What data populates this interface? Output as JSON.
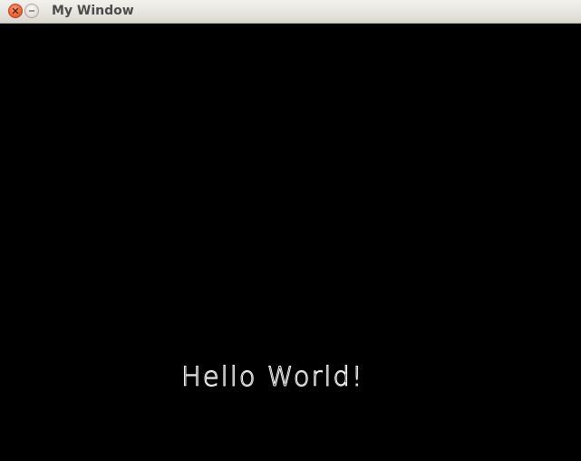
{
  "window": {
    "title": "My Window",
    "close_icon": "close-icon",
    "minimize_icon": "minimize-icon"
  },
  "canvas": {
    "background_color": "#000000",
    "text": "Hello World!",
    "text_color": "#ffffff"
  },
  "colors": {
    "close_button": "#f0693c",
    "titlebar": "#e6e4de"
  }
}
